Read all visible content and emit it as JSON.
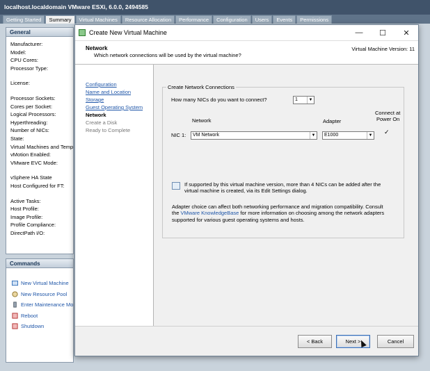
{
  "host": {
    "title": "localhost.localdomain VMware ESXi, 6.0.0, 2494585",
    "tabs": [
      "Getting Started",
      "Summary",
      "Virtual Machines",
      "Resource Allocation",
      "Performance",
      "Configuration",
      "Users",
      "Events",
      "Permissions"
    ],
    "active_tab": "Summary",
    "general": {
      "title": "General",
      "labels": [
        "Manufacturer:",
        "Model:",
        "CPU Cores:",
        "Processor Type:",
        "",
        "License:",
        "",
        "Processor Sockets:",
        "Cores per Socket:",
        "Logical Processors:",
        "Hyperthreading:",
        "Number of NICs:",
        "State:",
        "Virtual Machines and Templates:",
        "vMotion Enabled:",
        "VMware EVC Mode:",
        "",
        "vSphere HA State",
        "Host Configured for FT:",
        "",
        "Active Tasks:",
        "Host Profile:",
        "Image Profile:",
        "Profile Compliance:",
        "DirectPath I/O:"
      ]
    },
    "commands": {
      "title": "Commands",
      "items": [
        {
          "label": "New Virtual Machine",
          "icon": "new-vm-icon"
        },
        {
          "label": "New Resource Pool",
          "icon": "resource-pool-icon"
        },
        {
          "label": "Enter Maintenance Mode",
          "icon": "maintenance-icon"
        },
        {
          "label": "Reboot",
          "icon": "reboot-icon"
        },
        {
          "label": "Shutdown",
          "icon": "shutdown-icon"
        }
      ]
    }
  },
  "dialog": {
    "title": "Create New Virtual Machine",
    "window_buttons": {
      "minimize": "—",
      "maximize": "☐",
      "close": "✕"
    },
    "header": {
      "heading": "Network",
      "subheading": "Which network connections will be used by the virtual machine?",
      "version": "Virtual Machine Version: 11"
    },
    "steps": [
      {
        "label": "Configuration",
        "state": "done"
      },
      {
        "label": "Name and Location",
        "state": "done"
      },
      {
        "label": "Storage",
        "state": "done"
      },
      {
        "label": "Guest Operating System",
        "state": "done"
      },
      {
        "label": "Network",
        "state": "current"
      },
      {
        "label": "Create a Disk",
        "state": "todo"
      },
      {
        "label": "Ready to Complete",
        "state": "todo"
      }
    ],
    "group_title": "Create Network Connections",
    "nic_question": "How many NICs do you want to connect?",
    "nic_count": "1",
    "columns": {
      "network": "Network",
      "adapter": "Adapter",
      "connect_line1": "Connect at",
      "connect_line2": "Power On"
    },
    "nic1": {
      "label": "NIC 1:",
      "network": "VM Network",
      "adapter": "E1000",
      "connect_checked": "✓"
    },
    "info_line1": "If supported by this virtual machine version, more than 4 NICs can be added after the",
    "info_line2": "virtual machine is created, via its Edit Settings dialog.",
    "adapter_note_line1": "Adapter choice can affect both networking performance and migration compatibility. Consult",
    "adapter_note_the": "the ",
    "adapter_note_link": "VMware KnowledgeBase",
    "adapter_note_rest": " for more information on choosing among the network adapters",
    "adapter_note_line3": "supported for various guest operating systems and hosts.",
    "buttons": {
      "back": "< Back",
      "next": "Next >",
      "cancel": "Cancel"
    }
  },
  "colors": {
    "accent": "#1f56a8",
    "title_bar": "#40536a"
  }
}
